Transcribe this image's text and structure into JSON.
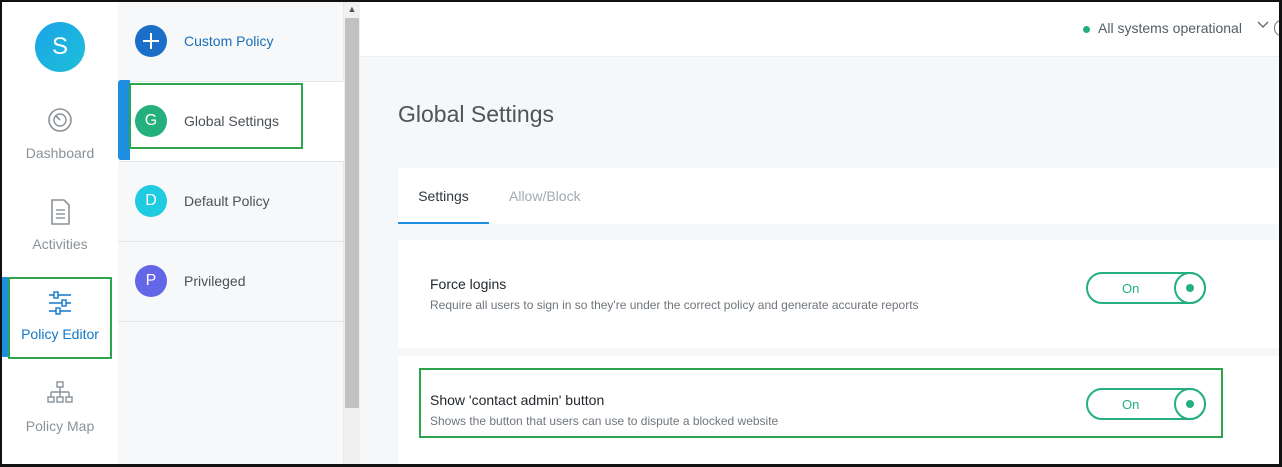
{
  "user": {
    "initial": "S"
  },
  "nav": {
    "items": [
      {
        "label": "Dashboard",
        "icon": "dashboard-gauge-icon"
      },
      {
        "label": "Activities",
        "icon": "document-list-icon"
      },
      {
        "label": "Policy Editor",
        "icon": "sliders-icon",
        "active": true
      },
      {
        "label": "Policy Map",
        "icon": "org-chart-icon"
      }
    ]
  },
  "policies": {
    "add_label": "Custom Policy",
    "items": [
      {
        "initial": "G",
        "label": "Global Settings",
        "color": "#23b07d",
        "selected": true
      },
      {
        "initial": "D",
        "label": "Default Policy",
        "color": "#1ecbe1"
      },
      {
        "initial": "P",
        "label": "Privileged",
        "color": "#6366e6"
      }
    ]
  },
  "header": {
    "status_text": "All systems operational",
    "status_color": "#23b07d"
  },
  "page": {
    "title": "Global Settings",
    "tabs": [
      {
        "label": "Settings",
        "active": true
      },
      {
        "label": "Allow/Block",
        "active": false
      }
    ],
    "settings": [
      {
        "title": "Force logins",
        "description": "Require all users to sign in so they're under the correct policy and generate accurate reports",
        "toggle_label": "On"
      },
      {
        "title": "Show 'contact admin' button",
        "description": "Shows the button that users can use to dispute a blocked website",
        "toggle_label": "On"
      }
    ]
  },
  "colors": {
    "accent": "#1d8fe0",
    "success": "#23b07d",
    "highlight": "#2ea44f"
  }
}
